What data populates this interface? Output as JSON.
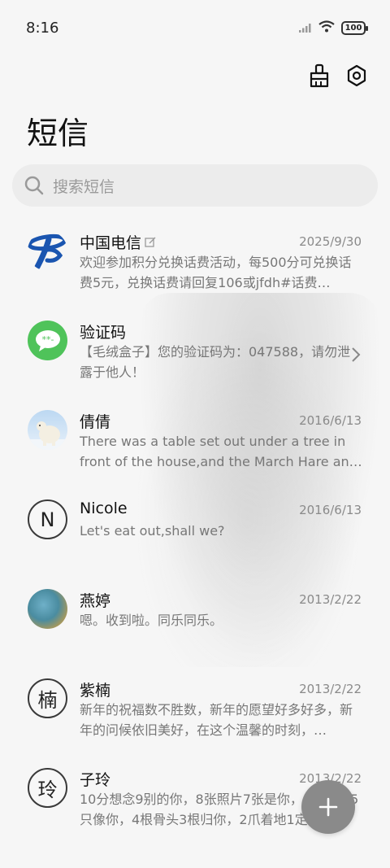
{
  "status": {
    "time": "8:16",
    "battery": "100"
  },
  "header": {
    "title": "短信"
  },
  "search": {
    "placeholder": "搜索短信"
  },
  "conversations": [
    {
      "name": "中国电信",
      "date": "2025/9/30",
      "preview": "欢迎参加积分兑换话费活动，每500分可兑换话费5元，兑换话费请回复106或jfdh#话费…",
      "avatar": "china-telecom-logo"
    },
    {
      "name": "验证码",
      "date": "",
      "preview": "【毛绒盒子】您的验证码为：047588，请勿泄露于他人！",
      "avatar": "message-bubble"
    },
    {
      "name": "倩倩",
      "date": "2016/6/13",
      "preview": "There was a table set out under a tree in front of the house,and the March Hare an…",
      "avatar": "polar-bear-photo"
    },
    {
      "name": "Nicole",
      "date": "2016/6/13",
      "preview": "Let's eat out,shall we?",
      "avatar_letter": "N"
    },
    {
      "name": "燕婷",
      "date": "2013/2/22",
      "preview": "嗯。收到啦。同乐同乐。",
      "avatar": "landscape-photo"
    },
    {
      "name": "紫楠",
      "date": "2013/2/22",
      "preview": "新年的祝福数不胜数，新年的愿望好多好多，新年的问候依旧美好，在这个温馨的时刻，…",
      "avatar_letter": "楠"
    },
    {
      "name": "子玲",
      "date": "2013/2/22",
      "preview": "10分想念9别的你，8张照片7张是你，6只小狗5只像你，4根骨头3根归你，2爪着地1定…",
      "avatar_letter": "玲"
    }
  ],
  "colors": {
    "telecom_blue": "#1a55b0",
    "verify_green": "#4fc35a",
    "fab_gray": "#8a8a8a"
  }
}
